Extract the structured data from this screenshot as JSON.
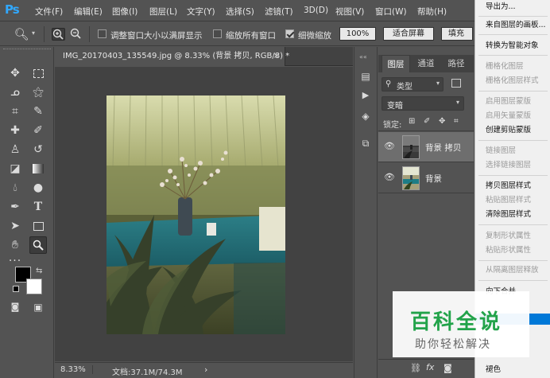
{
  "app": {
    "logo": "Ps"
  },
  "menubar": {
    "items": [
      "文件(F)",
      "编辑(E)",
      "图像(I)",
      "图层(L)",
      "文字(Y)",
      "选择(S)",
      "滤镜(T)",
      "3D(D)",
      "视图(V)",
      "窗口(W)",
      "帮助(H)"
    ]
  },
  "options": {
    "resize_windows": "调整窗口大小以满屏显示",
    "zoom_all": "缩放所有窗口",
    "scrubby_zoom": "细微缩放",
    "zoom_100": "100%",
    "fit_screen": "适合屏幕",
    "fill_screen": "填充"
  },
  "document": {
    "tab_title": "IMG_20170403_135549.jpg @ 8.33% (背景 拷贝, RGB/8) *",
    "close_glyph": "×",
    "zoom": "8.33%",
    "doc_size": "文档:37.1M/74.3M",
    "status_arrow": "›"
  },
  "layers_panel": {
    "tabs": [
      "图层",
      "通道",
      "路径"
    ],
    "filter_kind": "类型",
    "blend_mode": "变暗",
    "lock_label": "锁定:",
    "layers": [
      {
        "name": "背景 拷贝",
        "selected": true
      },
      {
        "name": "背景",
        "selected": false
      }
    ],
    "footer_fx": "fx"
  },
  "context_menu": {
    "items": [
      {
        "label": "导出为...",
        "enabled": true
      },
      {
        "label": "来自图层的画板...",
        "enabled": true
      },
      {
        "label": "转换为智能对象",
        "enabled": true
      },
      {
        "label": "栅格化图层",
        "enabled": false
      },
      {
        "label": "栅格化图层样式",
        "enabled": false
      },
      {
        "label": "启用图层蒙版",
        "enabled": false
      },
      {
        "label": "启用矢量蒙版",
        "enabled": false
      },
      {
        "label": "创建剪贴蒙版",
        "enabled": true
      },
      {
        "label": "链接图层",
        "enabled": false
      },
      {
        "label": "选择链接图层",
        "enabled": false
      },
      {
        "label": "拷贝图层样式",
        "enabled": true
      },
      {
        "label": "粘贴图层样式",
        "enabled": false
      },
      {
        "label": "清除图层样式",
        "enabled": true
      },
      {
        "label": "复制形状属性",
        "enabled": false
      },
      {
        "label": "粘贴形状属性",
        "enabled": false
      },
      {
        "label": "从隔离图层释放",
        "enabled": false
      },
      {
        "label": "向下合并",
        "enabled": true
      },
      {
        "label": "褪色",
        "enabled": true
      }
    ]
  },
  "watermark": {
    "brand": "百科全说",
    "tagline": "助你轻松解决"
  },
  "colors": {
    "accent": "#31a8ff",
    "panel": "#535353",
    "highlight": "#0078d7",
    "watermark_green": "#22a34a"
  }
}
